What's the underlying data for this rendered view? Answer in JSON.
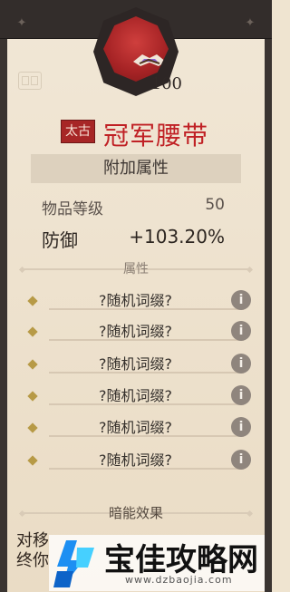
{
  "item": {
    "level": "100",
    "rarity_tag": "太古",
    "name": "冠军腰带",
    "section_title": "附加属性",
    "item_level_label": "物品等级",
    "item_level_value": "50",
    "defense_label": "防御",
    "defense_value": "+103.20%"
  },
  "sections": {
    "attributes_label": "属性",
    "dark_effect_label": "暗能效果"
  },
  "affixes": [
    {
      "label": "?随机词缀?",
      "icon": "info-icon"
    },
    {
      "label": "?随机词缀?",
      "icon": "info-icon"
    },
    {
      "label": "?随机词缀?",
      "icon": "info-icon"
    },
    {
      "label": "?随机词缀?",
      "icon": "info-icon"
    },
    {
      "label": "?随机词缀?",
      "icon": "info-icon"
    },
    {
      "label": "?随机词缀?",
      "icon": "info-icon"
    }
  ],
  "effect": {
    "text_line_1": "对移",
    "text_line_2": "终你"
  },
  "watermark": {
    "title": "宝佳攻略网",
    "url": "www.dzbaojia.com"
  },
  "colors": {
    "accent_red": "#c02125",
    "dark_frame": "#332d2b",
    "panel_bg": "#efe4d0"
  }
}
